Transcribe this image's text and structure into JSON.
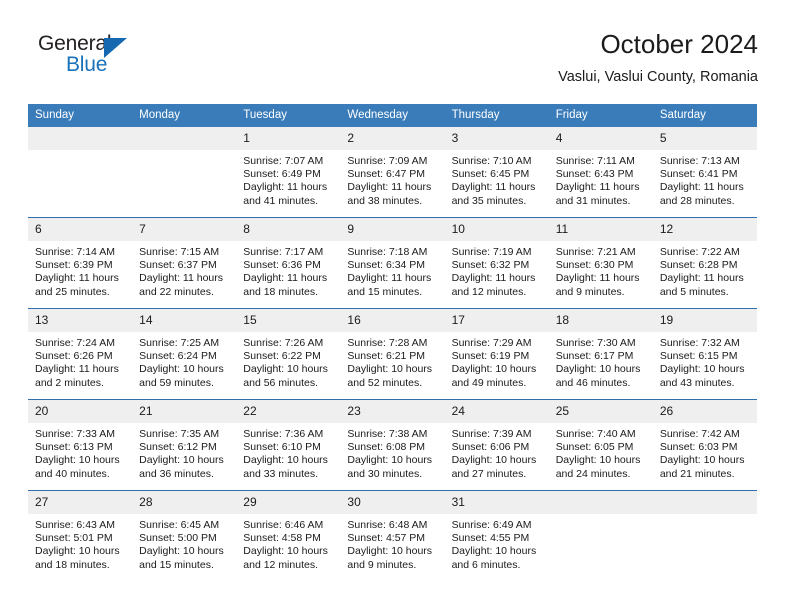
{
  "brand": {
    "name_part1": "General",
    "name_part2": "Blue"
  },
  "header": {
    "title": "October 2024",
    "subtitle": "Vaslui, Vaslui County, Romania"
  },
  "colors": {
    "header_blue": "#3a7cb9",
    "rule_blue": "#2f6fae",
    "daynum_band": "#efefef",
    "logo_blue": "#1a72ba",
    "text": "#1b1b1b"
  },
  "weekdays": [
    "Sunday",
    "Monday",
    "Tuesday",
    "Wednesday",
    "Thursday",
    "Friday",
    "Saturday"
  ],
  "weeks": [
    [
      {
        "day": "",
        "sunrise": "",
        "sunset": "",
        "daylight_line1": "",
        "daylight_line2": ""
      },
      {
        "day": "",
        "sunrise": "",
        "sunset": "",
        "daylight_line1": "",
        "daylight_line2": ""
      },
      {
        "day": "1",
        "sunrise": "Sunrise: 7:07 AM",
        "sunset": "Sunset: 6:49 PM",
        "daylight_line1": "Daylight: 11 hours",
        "daylight_line2": "and 41 minutes."
      },
      {
        "day": "2",
        "sunrise": "Sunrise: 7:09 AM",
        "sunset": "Sunset: 6:47 PM",
        "daylight_line1": "Daylight: 11 hours",
        "daylight_line2": "and 38 minutes."
      },
      {
        "day": "3",
        "sunrise": "Sunrise: 7:10 AM",
        "sunset": "Sunset: 6:45 PM",
        "daylight_line1": "Daylight: 11 hours",
        "daylight_line2": "and 35 minutes."
      },
      {
        "day": "4",
        "sunrise": "Sunrise: 7:11 AM",
        "sunset": "Sunset: 6:43 PM",
        "daylight_line1": "Daylight: 11 hours",
        "daylight_line2": "and 31 minutes."
      },
      {
        "day": "5",
        "sunrise": "Sunrise: 7:13 AM",
        "sunset": "Sunset: 6:41 PM",
        "daylight_line1": "Daylight: 11 hours",
        "daylight_line2": "and 28 minutes."
      }
    ],
    [
      {
        "day": "6",
        "sunrise": "Sunrise: 7:14 AM",
        "sunset": "Sunset: 6:39 PM",
        "daylight_line1": "Daylight: 11 hours",
        "daylight_line2": "and 25 minutes."
      },
      {
        "day": "7",
        "sunrise": "Sunrise: 7:15 AM",
        "sunset": "Sunset: 6:37 PM",
        "daylight_line1": "Daylight: 11 hours",
        "daylight_line2": "and 22 minutes."
      },
      {
        "day": "8",
        "sunrise": "Sunrise: 7:17 AM",
        "sunset": "Sunset: 6:36 PM",
        "daylight_line1": "Daylight: 11 hours",
        "daylight_line2": "and 18 minutes."
      },
      {
        "day": "9",
        "sunrise": "Sunrise: 7:18 AM",
        "sunset": "Sunset: 6:34 PM",
        "daylight_line1": "Daylight: 11 hours",
        "daylight_line2": "and 15 minutes."
      },
      {
        "day": "10",
        "sunrise": "Sunrise: 7:19 AM",
        "sunset": "Sunset: 6:32 PM",
        "daylight_line1": "Daylight: 11 hours",
        "daylight_line2": "and 12 minutes."
      },
      {
        "day": "11",
        "sunrise": "Sunrise: 7:21 AM",
        "sunset": "Sunset: 6:30 PM",
        "daylight_line1": "Daylight: 11 hours",
        "daylight_line2": "and 9 minutes."
      },
      {
        "day": "12",
        "sunrise": "Sunrise: 7:22 AM",
        "sunset": "Sunset: 6:28 PM",
        "daylight_line1": "Daylight: 11 hours",
        "daylight_line2": "and 5 minutes."
      }
    ],
    [
      {
        "day": "13",
        "sunrise": "Sunrise: 7:24 AM",
        "sunset": "Sunset: 6:26 PM",
        "daylight_line1": "Daylight: 11 hours",
        "daylight_line2": "and 2 minutes."
      },
      {
        "day": "14",
        "sunrise": "Sunrise: 7:25 AM",
        "sunset": "Sunset: 6:24 PM",
        "daylight_line1": "Daylight: 10 hours",
        "daylight_line2": "and 59 minutes."
      },
      {
        "day": "15",
        "sunrise": "Sunrise: 7:26 AM",
        "sunset": "Sunset: 6:22 PM",
        "daylight_line1": "Daylight: 10 hours",
        "daylight_line2": "and 56 minutes."
      },
      {
        "day": "16",
        "sunrise": "Sunrise: 7:28 AM",
        "sunset": "Sunset: 6:21 PM",
        "daylight_line1": "Daylight: 10 hours",
        "daylight_line2": "and 52 minutes."
      },
      {
        "day": "17",
        "sunrise": "Sunrise: 7:29 AM",
        "sunset": "Sunset: 6:19 PM",
        "daylight_line1": "Daylight: 10 hours",
        "daylight_line2": "and 49 minutes."
      },
      {
        "day": "18",
        "sunrise": "Sunrise: 7:30 AM",
        "sunset": "Sunset: 6:17 PM",
        "daylight_line1": "Daylight: 10 hours",
        "daylight_line2": "and 46 minutes."
      },
      {
        "day": "19",
        "sunrise": "Sunrise: 7:32 AM",
        "sunset": "Sunset: 6:15 PM",
        "daylight_line1": "Daylight: 10 hours",
        "daylight_line2": "and 43 minutes."
      }
    ],
    [
      {
        "day": "20",
        "sunrise": "Sunrise: 7:33 AM",
        "sunset": "Sunset: 6:13 PM",
        "daylight_line1": "Daylight: 10 hours",
        "daylight_line2": "and 40 minutes."
      },
      {
        "day": "21",
        "sunrise": "Sunrise: 7:35 AM",
        "sunset": "Sunset: 6:12 PM",
        "daylight_line1": "Daylight: 10 hours",
        "daylight_line2": "and 36 minutes."
      },
      {
        "day": "22",
        "sunrise": "Sunrise: 7:36 AM",
        "sunset": "Sunset: 6:10 PM",
        "daylight_line1": "Daylight: 10 hours",
        "daylight_line2": "and 33 minutes."
      },
      {
        "day": "23",
        "sunrise": "Sunrise: 7:38 AM",
        "sunset": "Sunset: 6:08 PM",
        "daylight_line1": "Daylight: 10 hours",
        "daylight_line2": "and 30 minutes."
      },
      {
        "day": "24",
        "sunrise": "Sunrise: 7:39 AM",
        "sunset": "Sunset: 6:06 PM",
        "daylight_line1": "Daylight: 10 hours",
        "daylight_line2": "and 27 minutes."
      },
      {
        "day": "25",
        "sunrise": "Sunrise: 7:40 AM",
        "sunset": "Sunset: 6:05 PM",
        "daylight_line1": "Daylight: 10 hours",
        "daylight_line2": "and 24 minutes."
      },
      {
        "day": "26",
        "sunrise": "Sunrise: 7:42 AM",
        "sunset": "Sunset: 6:03 PM",
        "daylight_line1": "Daylight: 10 hours",
        "daylight_line2": "and 21 minutes."
      }
    ],
    [
      {
        "day": "27",
        "sunrise": "Sunrise: 6:43 AM",
        "sunset": "Sunset: 5:01 PM",
        "daylight_line1": "Daylight: 10 hours",
        "daylight_line2": "and 18 minutes."
      },
      {
        "day": "28",
        "sunrise": "Sunrise: 6:45 AM",
        "sunset": "Sunset: 5:00 PM",
        "daylight_line1": "Daylight: 10 hours",
        "daylight_line2": "and 15 minutes."
      },
      {
        "day": "29",
        "sunrise": "Sunrise: 6:46 AM",
        "sunset": "Sunset: 4:58 PM",
        "daylight_line1": "Daylight: 10 hours",
        "daylight_line2": "and 12 minutes."
      },
      {
        "day": "30",
        "sunrise": "Sunrise: 6:48 AM",
        "sunset": "Sunset: 4:57 PM",
        "daylight_line1": "Daylight: 10 hours",
        "daylight_line2": "and 9 minutes."
      },
      {
        "day": "31",
        "sunrise": "Sunrise: 6:49 AM",
        "sunset": "Sunset: 4:55 PM",
        "daylight_line1": "Daylight: 10 hours",
        "daylight_line2": "and 6 minutes."
      },
      {
        "day": "",
        "sunrise": "",
        "sunset": "",
        "daylight_line1": "",
        "daylight_line2": ""
      },
      {
        "day": "",
        "sunrise": "",
        "sunset": "",
        "daylight_line1": "",
        "daylight_line2": ""
      }
    ]
  ]
}
